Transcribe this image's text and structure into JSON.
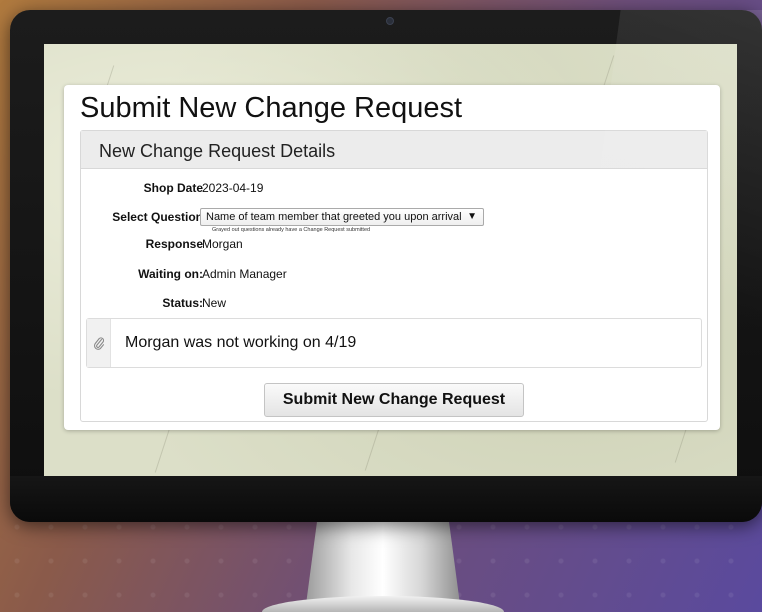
{
  "page": {
    "title": "Submit New Change Request"
  },
  "panel": {
    "header": "New Change Request Details",
    "fields": {
      "shop_date": {
        "label": "Shop Date",
        "value": "2023-04-19"
      },
      "select_question": {
        "label": "Select Question",
        "selected": "Name of team member that greeted you upon arrival",
        "hint": "Grayed out questions already have a Change Request submitted"
      },
      "response": {
        "label": "Response",
        "value": "Morgan"
      },
      "waiting_on": {
        "label": "Waiting on:",
        "value": "Admin Manager"
      },
      "status": {
        "label": "Status:",
        "value": "New"
      }
    },
    "note": {
      "icon": "paperclip-icon",
      "text": "Morgan was not working on 4/19"
    },
    "submit_label": "Submit New Change Request"
  },
  "colors": {
    "card_background": "#ffffff",
    "panel_header": "#ececec",
    "screen_wallpaper": "#dcdfc8",
    "monitor_bezel": "#111111"
  }
}
